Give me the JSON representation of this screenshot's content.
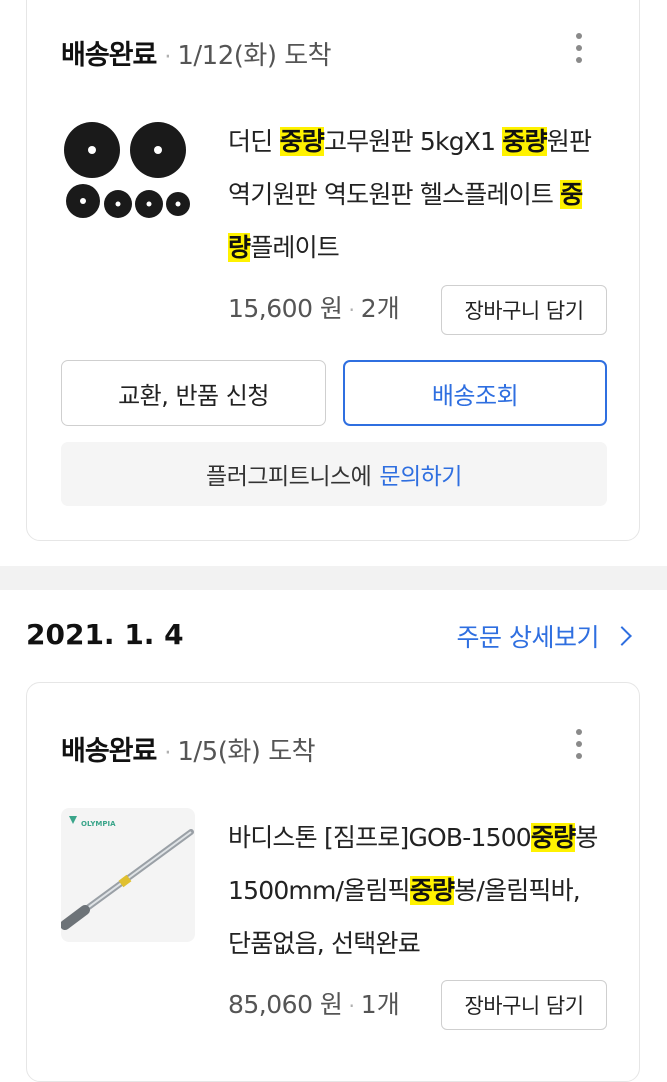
{
  "orders": [
    {
      "status": "배송완료",
      "arrival": "1/12(화) 도착",
      "product": {
        "title_parts": [
          "더딘 ",
          "중량",
          "고무원판 5kgX1 ",
          "중량",
          "원판 역기원판 역도원판 헬스플레이트 ",
          "중",
          "량",
          "플레이트"
        ],
        "price": "15,600 원",
        "qty": "2개",
        "thumb_icon": "weight-plates-image"
      },
      "cart_label": "장바구니 담기",
      "exchange_label": "교환, 반품 신청",
      "track_label": "배송조회",
      "inquiry_text": "플러그피트니스에",
      "inquiry_link": "문의하기"
    },
    {
      "date": "2021. 1. 4",
      "detail_label": "주문 상세보기",
      "status": "배송완료",
      "arrival": "1/5(화) 도착",
      "product": {
        "title_parts": [
          "바디스톤 [짐프로]GOB-1500",
          "중량",
          "봉 1500mm/올림픽",
          "중량",
          "봉/올림픽바, 단품없음, 선택완료"
        ],
        "price": "85,060 원",
        "qty": "1개",
        "thumb_icon": "olympic-barbell-image",
        "brand": "OLYMPIA"
      },
      "cart_label": "장바구니 담기"
    }
  ],
  "colors": {
    "accent": "#2f6fe0",
    "highlight": "#fff200"
  }
}
